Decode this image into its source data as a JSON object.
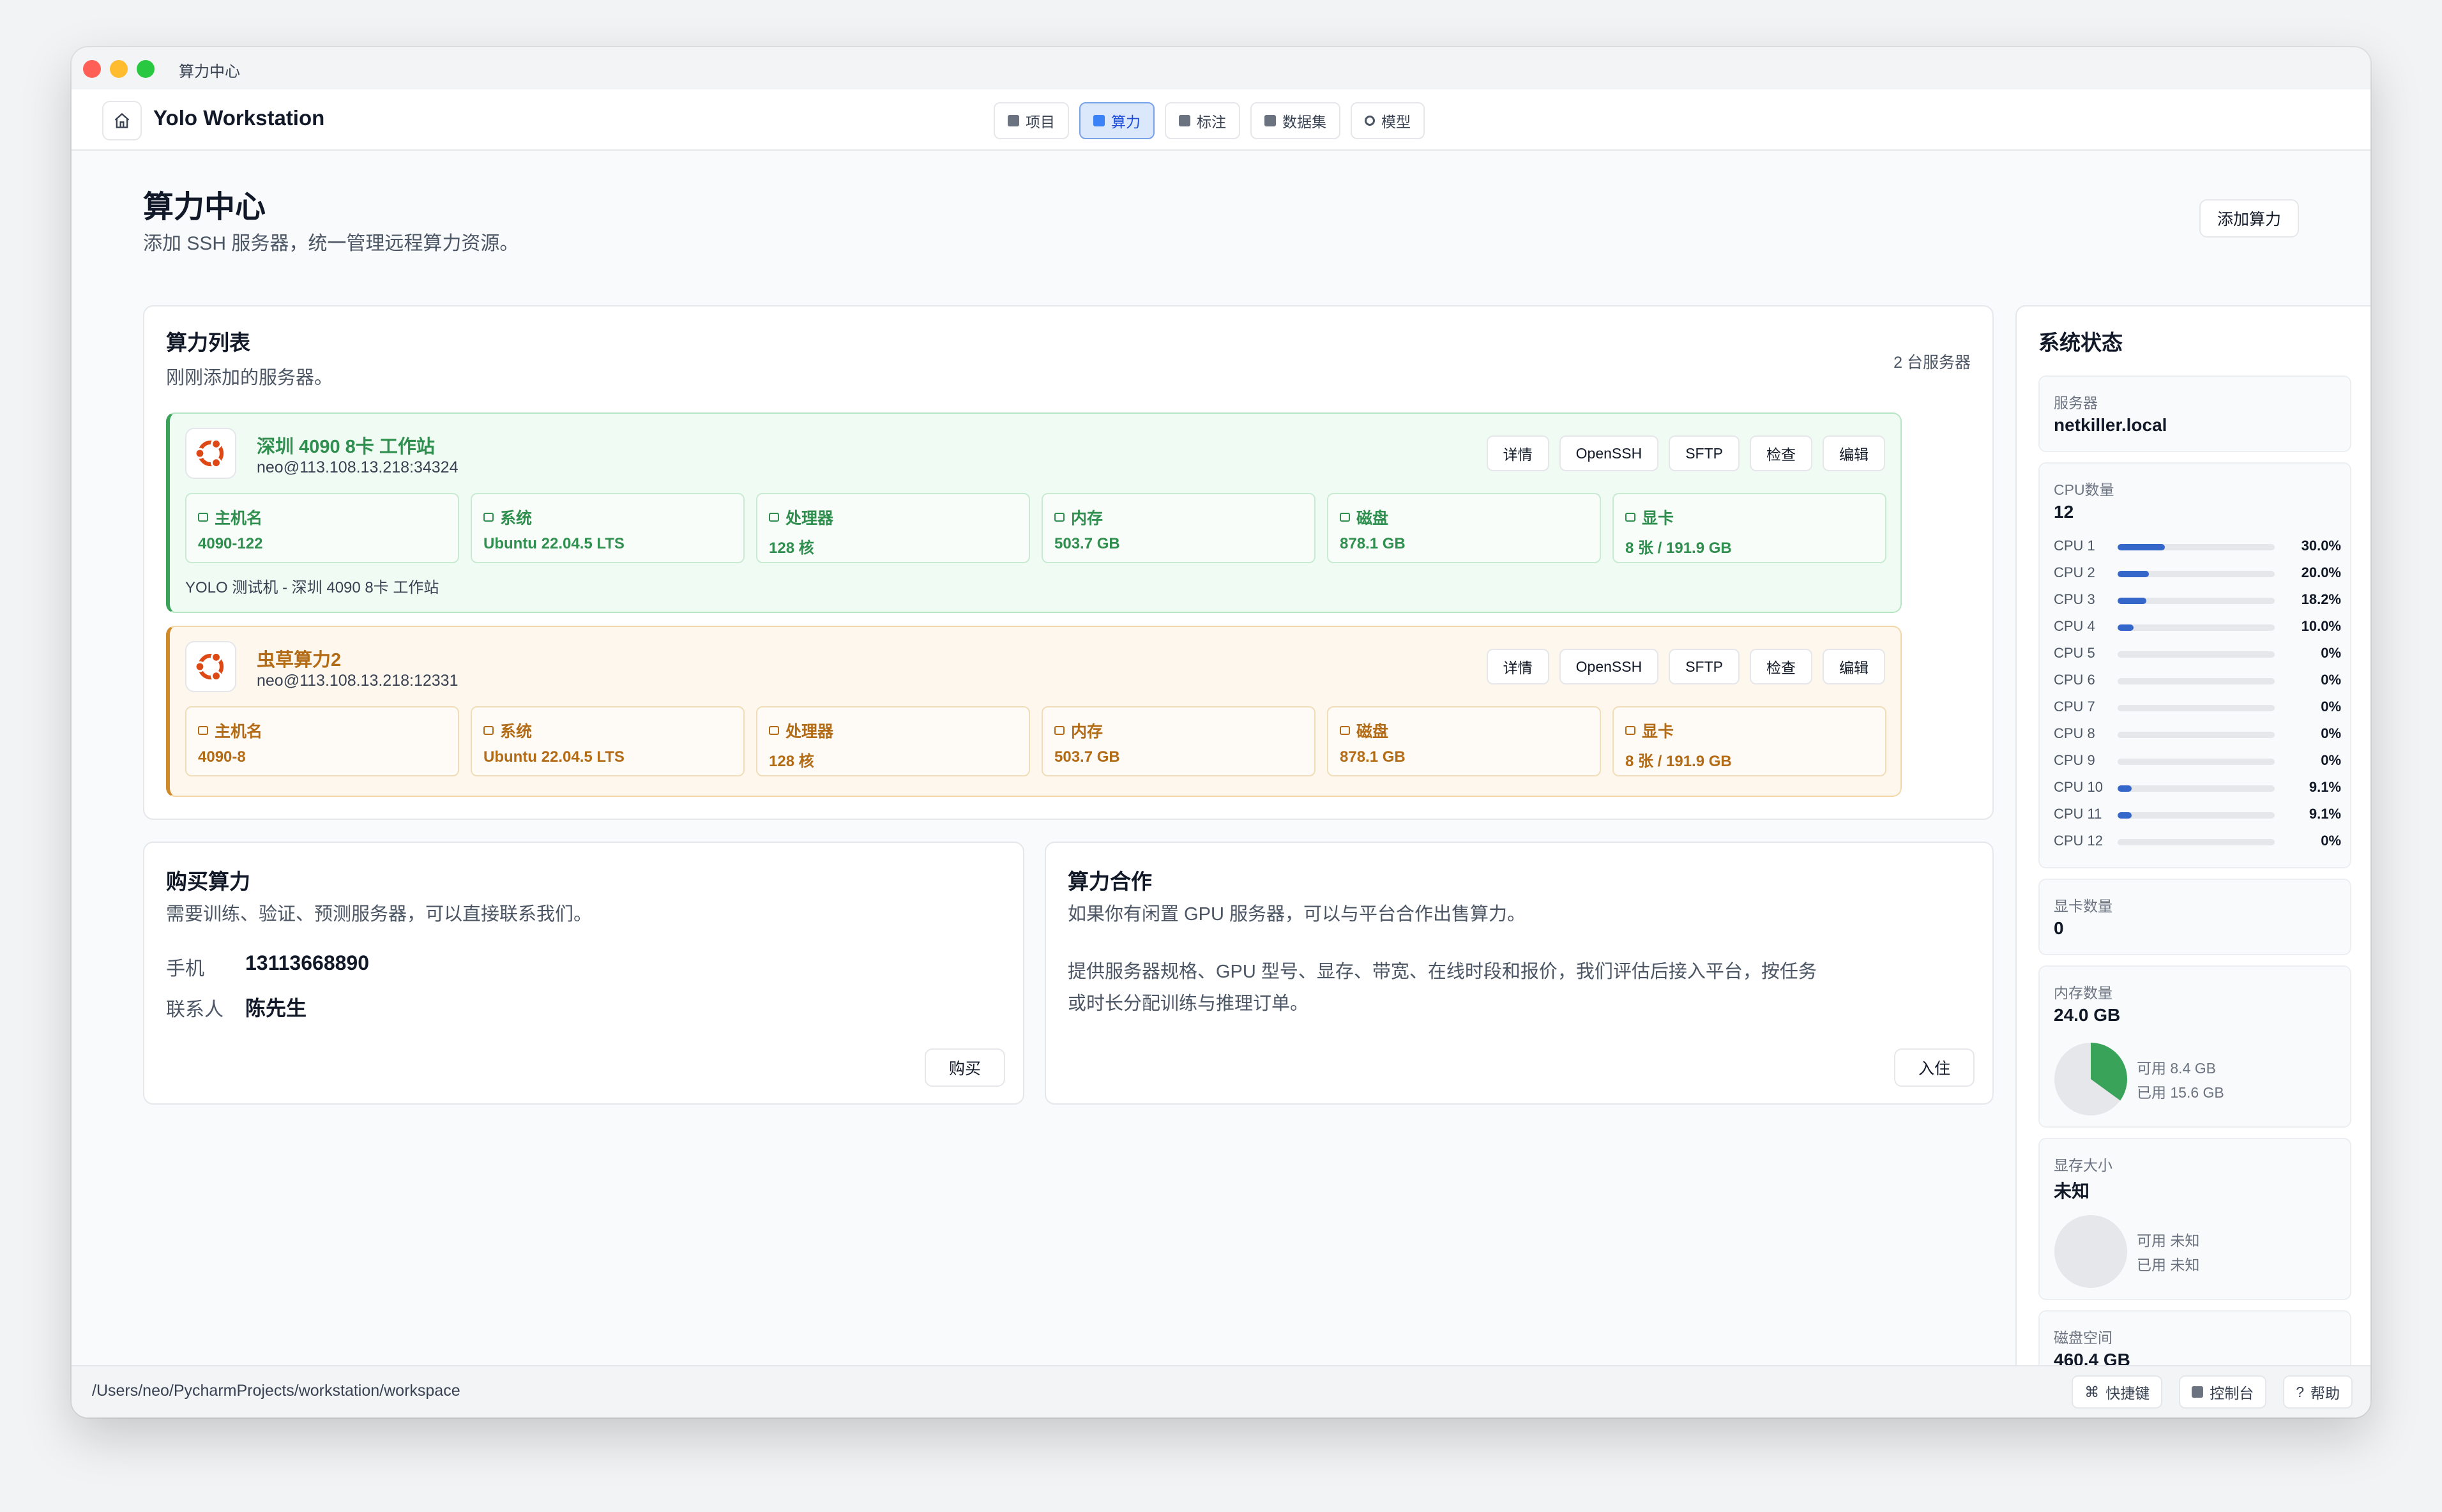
{
  "window": {
    "title": "算力中心"
  },
  "app": {
    "name": "Yolo Workstation",
    "nav": [
      {
        "label": "项目",
        "icon": "square-icon",
        "active": false
      },
      {
        "label": "算力",
        "icon": "square-icon",
        "active": true
      },
      {
        "label": "标注",
        "icon": "square-icon",
        "active": false
      },
      {
        "label": "数据集",
        "icon": "square-icon",
        "active": false
      },
      {
        "label": "模型",
        "icon": "ring-icon",
        "active": false
      }
    ]
  },
  "page": {
    "title": "算力中心",
    "subtitle": "添加 SSH 服务器，统一管理远程算力资源。",
    "add_button": "添加算力"
  },
  "compute_list": {
    "title": "算力列表",
    "subtitle": "刚刚添加的服务器。",
    "count": "2 台服务器",
    "actions": [
      "详情",
      "OpenSSH",
      "SFTP",
      "检查",
      "编辑"
    ],
    "spec_labels": {
      "host": "主机名",
      "os": "系统",
      "cpu": "处理器",
      "mem": "内存",
      "disk": "磁盘",
      "gpu": "显卡"
    },
    "servers": [
      {
        "name": "深圳 4090 8卡 工作站",
        "address": "neo@113.108.13.218:34324",
        "accent": "#3aa35a",
        "host": "4090-122",
        "os": "Ubuntu 22.04.5 LTS",
        "cpu": "128 核",
        "mem": "503.7 GB",
        "disk": "878.1 GB",
        "gpu": "8 张 / 191.9 GB",
        "note": "YOLO 测试机 - 深圳 4090 8卡 工作站"
      },
      {
        "name": "虫草算力2",
        "address": "neo@113.108.13.218:12331",
        "accent": "#d08a2a",
        "host": "4090-8",
        "os": "Ubuntu 22.04.5 LTS",
        "cpu": "128 核",
        "mem": "503.7 GB",
        "disk": "878.1 GB",
        "gpu": "8 张 / 191.9 GB"
      }
    ]
  },
  "buy": {
    "title": "购买算力",
    "subtitle": "需要训练、验证、预测服务器，可以直接联系我们。",
    "phone_label": "手机",
    "phone": "13113668890",
    "contact_label": "联系人",
    "contact": "陈先生",
    "button": "购买"
  },
  "partner": {
    "title": "算力合作",
    "subtitle": "如果你有闲置 GPU 服务器，可以与平台合作出售算力。",
    "body_line1": "提供服务器规格、GPU 型号、显存、带宽、在线时段和报价，我们评估后接入平台，按任务",
    "body_line2": "或时长分配训练与推理订单。",
    "button": "入住"
  },
  "system": {
    "title": "系统状态",
    "server_label": "服务器",
    "server": "netkiller.local",
    "cpu_label": "CPU数量",
    "cpu_count": "12",
    "cpus": [
      {
        "name": "CPU 1",
        "pct": "30.0%",
        "value": 30.0
      },
      {
        "name": "CPU 2",
        "pct": "20.0%",
        "value": 20.0
      },
      {
        "name": "CPU 3",
        "pct": "18.2%",
        "value": 18.2
      },
      {
        "name": "CPU 4",
        "pct": "10.0%",
        "value": 10.0
      },
      {
        "name": "CPU 5",
        "pct": "0%",
        "value": 0
      },
      {
        "name": "CPU 6",
        "pct": "0%",
        "value": 0
      },
      {
        "name": "CPU 7",
        "pct": "0%",
        "value": 0
      },
      {
        "name": "CPU 8",
        "pct": "0%",
        "value": 0
      },
      {
        "name": "CPU 9",
        "pct": "0%",
        "value": 0
      },
      {
        "name": "CPU 10",
        "pct": "9.1%",
        "value": 9.1
      },
      {
        "name": "CPU 11",
        "pct": "9.1%",
        "value": 9.1
      },
      {
        "name": "CPU 12",
        "pct": "0%",
        "value": 0
      }
    ],
    "gpu_label": "显卡数量",
    "gpu_count": "0",
    "mem_label": "内存数量",
    "mem_total": "24.0 GB",
    "mem_free": "可用 8.4 GB",
    "mem_used": "已用 15.6 GB",
    "mem_free_fraction": 0.35,
    "vram_label": "显存大小",
    "vram_total": "未知",
    "vram_free": "可用 未知",
    "vram_used": "已用 未知",
    "disk_label": "磁盘空间",
    "disk_total": "460.4 GB"
  },
  "statusbar": {
    "path": "/Users/neo/PycharmProjects/workstation/workspace",
    "shortcuts": "快捷键",
    "console": "控制台",
    "help": "帮助"
  },
  "colors": {
    "accent": "#3566c9",
    "green": "#3aa35a",
    "orange": "#d08a2a",
    "pie": "#3aa35a"
  }
}
